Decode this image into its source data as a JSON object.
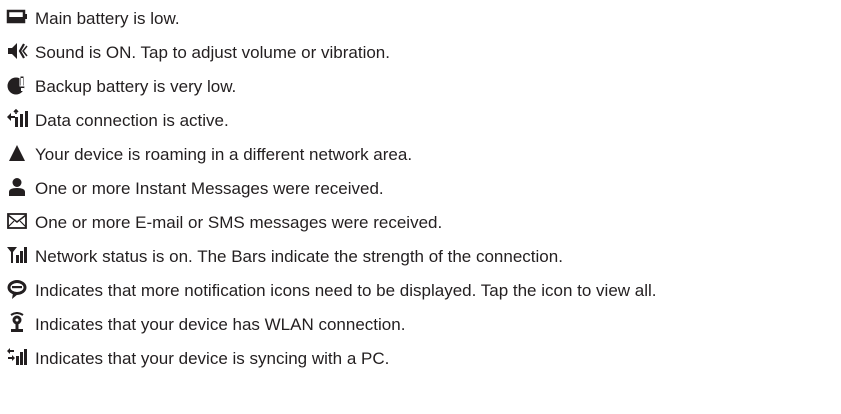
{
  "legend": {
    "items": [
      {
        "icon": "low-battery-icon",
        "text": "Main battery is low."
      },
      {
        "icon": "speaker-icon",
        "text": "Sound is ON. Tap to adjust volume or vibration."
      },
      {
        "icon": "backup-battery-icon",
        "text": "Backup battery is very low."
      },
      {
        "icon": "data-connection-icon",
        "text": "Data connection is active."
      },
      {
        "icon": "roaming-icon",
        "text": "Your device is roaming in a different network area."
      },
      {
        "icon": "person-icon",
        "text": "One or more Instant Messages were received."
      },
      {
        "icon": "envelope-icon",
        "text": "One or more E-mail or SMS messages were received."
      },
      {
        "icon": "signal-bars-icon",
        "text": "Network status is on. The Bars indicate the strength of the connection."
      },
      {
        "icon": "speech-bubble-icon",
        "text": "Indicates that more notification icons need to be displayed. Tap the icon to view all."
      },
      {
        "icon": "wlan-icon",
        "text": "Indicates that your device has WLAN connection."
      },
      {
        "icon": "sync-icon",
        "text": "Indicates that your device is syncing with a PC."
      }
    ]
  }
}
